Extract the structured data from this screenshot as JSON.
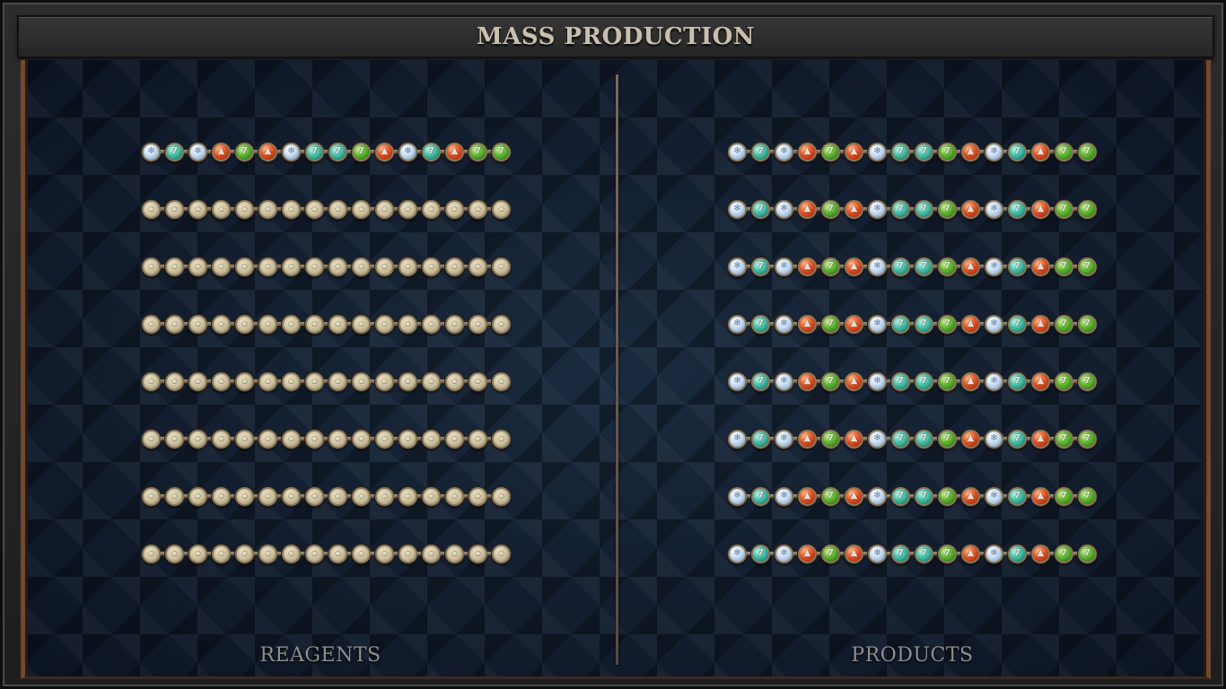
{
  "title": "MASS PRODUCTION",
  "reagents": {
    "label": "REAGENTS",
    "rows": [
      [
        "white",
        "teal",
        "white",
        "red",
        "green",
        "red",
        "white",
        "teal",
        "teal",
        "green",
        "red",
        "white",
        "teal",
        "red",
        "green",
        "green"
      ],
      [
        "empty",
        "empty",
        "empty",
        "empty",
        "empty",
        "empty",
        "empty",
        "empty",
        "empty",
        "empty",
        "empty",
        "empty",
        "empty",
        "empty",
        "empty",
        "empty"
      ],
      [
        "empty",
        "empty",
        "empty",
        "empty",
        "empty",
        "empty",
        "empty",
        "empty",
        "empty",
        "empty",
        "empty",
        "empty",
        "empty",
        "empty",
        "empty",
        "empty"
      ],
      [
        "empty",
        "empty",
        "empty",
        "empty",
        "empty",
        "empty",
        "empty",
        "empty",
        "empty",
        "empty",
        "empty",
        "empty",
        "empty",
        "empty",
        "empty",
        "empty"
      ],
      [
        "empty",
        "empty",
        "empty",
        "empty",
        "empty",
        "empty",
        "empty",
        "empty",
        "empty",
        "empty",
        "empty",
        "empty",
        "empty",
        "empty",
        "empty",
        "empty"
      ],
      [
        "empty",
        "empty",
        "empty",
        "empty",
        "empty",
        "empty",
        "empty",
        "empty",
        "empty",
        "empty",
        "empty",
        "empty",
        "empty",
        "empty",
        "empty",
        "empty"
      ],
      [
        "empty",
        "empty",
        "empty",
        "empty",
        "empty",
        "empty",
        "empty",
        "empty",
        "empty",
        "empty",
        "empty",
        "empty",
        "empty",
        "empty",
        "empty",
        "empty"
      ],
      [
        "empty",
        "empty",
        "empty",
        "empty",
        "empty",
        "empty",
        "empty",
        "empty",
        "empty",
        "empty",
        "empty",
        "empty",
        "empty",
        "empty",
        "empty",
        "empty"
      ]
    ]
  },
  "products": {
    "label": "PRODUCTS",
    "rows": [
      [
        "white",
        "teal",
        "white",
        "red",
        "green",
        "red",
        "white",
        "teal",
        "teal",
        "green",
        "red",
        "white",
        "teal",
        "red",
        "green",
        "green"
      ],
      [
        "white",
        "teal",
        "white",
        "red",
        "green",
        "red",
        "white",
        "teal",
        "teal",
        "green",
        "red",
        "white",
        "teal",
        "red",
        "green",
        "green"
      ],
      [
        "white",
        "teal",
        "white",
        "red",
        "green",
        "red",
        "white",
        "teal",
        "teal",
        "green",
        "red",
        "white",
        "teal",
        "red",
        "green",
        "green"
      ],
      [
        "white",
        "teal",
        "white",
        "red",
        "green",
        "red",
        "white",
        "teal",
        "teal",
        "green",
        "red",
        "white",
        "teal",
        "red",
        "green",
        "green"
      ],
      [
        "white",
        "teal",
        "white",
        "red",
        "green",
        "red",
        "white",
        "teal",
        "teal",
        "green",
        "red",
        "white",
        "teal",
        "red",
        "green",
        "green"
      ],
      [
        "white",
        "teal",
        "white",
        "red",
        "green",
        "red",
        "white",
        "teal",
        "teal",
        "green",
        "red",
        "white",
        "teal",
        "red",
        "green",
        "green"
      ],
      [
        "white",
        "teal",
        "white",
        "red",
        "green",
        "red",
        "white",
        "teal",
        "teal",
        "green",
        "red",
        "white",
        "teal",
        "red",
        "green",
        "green"
      ],
      [
        "white",
        "teal",
        "white",
        "red",
        "green",
        "red",
        "white",
        "teal",
        "teal",
        "green",
        "red",
        "white",
        "teal",
        "red",
        "green",
        "green"
      ]
    ]
  },
  "orb_types": {
    "white": {
      "color": "#c6ddf5",
      "icon": "frost-rune-icon"
    },
    "teal": {
      "color": "#3fc1a8",
      "icon": "air-rune-icon"
    },
    "red": {
      "color": "#f0501c",
      "icon": "fire-rune-icon"
    },
    "green": {
      "color": "#5ab82a",
      "icon": "earth-rune-icon"
    },
    "empty": {
      "color": "#c8bc98",
      "icon": "empty-slot-icon"
    }
  },
  "colors": {
    "title_text": "#c9bfae",
    "label_text": "#8f8f8f",
    "board_bg": "#10192a",
    "frame_wood": "#6e4a2e"
  }
}
